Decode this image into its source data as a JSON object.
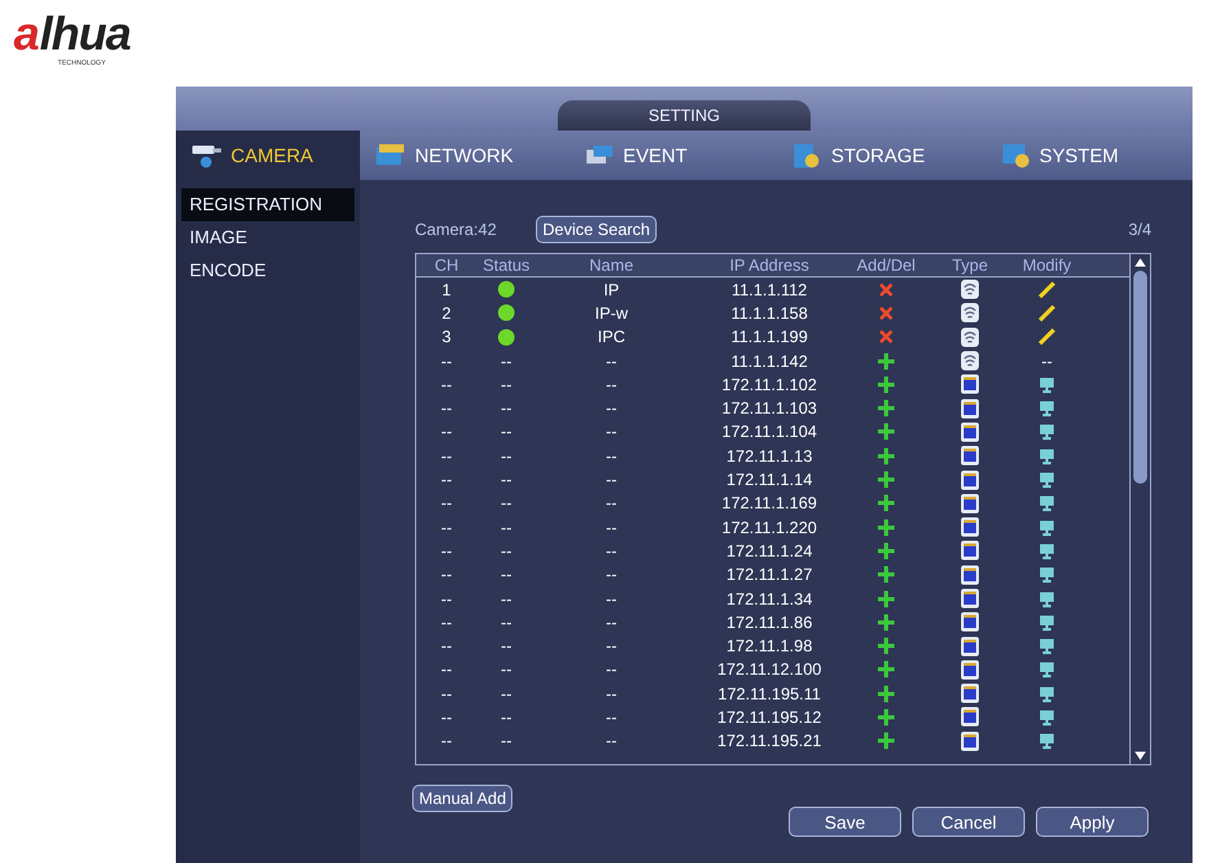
{
  "logo": {
    "mark": "a",
    "name": "lhua",
    "tagline": "TECHNOLOGY"
  },
  "window": {
    "title": "SETTING"
  },
  "tabs": [
    {
      "label": "CAMERA",
      "kind": "camera",
      "selected": true
    },
    {
      "label": "NETWORK",
      "kind": "network",
      "selected": false
    },
    {
      "label": "EVENT",
      "kind": "event",
      "selected": false
    },
    {
      "label": "STORAGE",
      "kind": "storage",
      "selected": false
    },
    {
      "label": "SYSTEM",
      "kind": "system",
      "selected": false
    }
  ],
  "sidebar": {
    "items": [
      {
        "label": "REGISTRATION",
        "selected": true
      },
      {
        "label": "IMAGE",
        "selected": false
      },
      {
        "label": "ENCODE",
        "selected": false
      }
    ]
  },
  "camera_count": "Camera:42",
  "device_search_button": "Device Search",
  "page": "3/4",
  "table": {
    "columns": [
      "CH",
      "Status",
      "Name",
      "IP Address",
      "Add/Del",
      "Type",
      "Modify"
    ],
    "rows": [
      {
        "ch": "1",
        "online": true,
        "name": "IP",
        "ip": "11.1.1.112",
        "action": {
          "kind": "delete"
        },
        "device": {
          "kind": "dome"
        },
        "modify": {
          "kind": "edit"
        }
      },
      {
        "ch": "2",
        "online": true,
        "name": "IP-w",
        "ip": "11.1.1.158",
        "action": {
          "kind": "delete"
        },
        "device": {
          "kind": "dome"
        },
        "modify": {
          "kind": "edit"
        }
      },
      {
        "ch": "3",
        "online": true,
        "name": "IPC",
        "ip": "11.1.1.199",
        "action": {
          "kind": "delete"
        },
        "device": {
          "kind": "dome"
        },
        "modify": {
          "kind": "edit"
        }
      },
      {
        "ch": "--",
        "status": "--",
        "name": "--",
        "ip": "11.1.1.142",
        "action": {
          "kind": "add"
        },
        "device": {
          "kind": "dome"
        },
        "modify": {
          "kind": "text",
          "text": "--"
        }
      },
      {
        "ch": "--",
        "status": "--",
        "name": "--",
        "ip": "172.11.1.102",
        "action": {
          "kind": "add"
        },
        "device": {
          "kind": "box"
        },
        "modify": {
          "kind": "network"
        }
      },
      {
        "ch": "--",
        "status": "--",
        "name": "--",
        "ip": "172.11.1.103",
        "action": {
          "kind": "add"
        },
        "device": {
          "kind": "box"
        },
        "modify": {
          "kind": "network"
        }
      },
      {
        "ch": "--",
        "status": "--",
        "name": "--",
        "ip": "172.11.1.104",
        "action": {
          "kind": "add"
        },
        "device": {
          "kind": "box"
        },
        "modify": {
          "kind": "network"
        }
      },
      {
        "ch": "--",
        "status": "--",
        "name": "--",
        "ip": "172.11.1.13",
        "action": {
          "kind": "add"
        },
        "device": {
          "kind": "box"
        },
        "modify": {
          "kind": "network"
        }
      },
      {
        "ch": "--",
        "status": "--",
        "name": "--",
        "ip": "172.11.1.14",
        "action": {
          "kind": "add"
        },
        "device": {
          "kind": "box"
        },
        "modify": {
          "kind": "network"
        }
      },
      {
        "ch": "--",
        "status": "--",
        "name": "--",
        "ip": "172.11.1.169",
        "action": {
          "kind": "add"
        },
        "device": {
          "kind": "box"
        },
        "modify": {
          "kind": "network"
        }
      },
      {
        "ch": "--",
        "status": "--",
        "name": "--",
        "ip": "172.11.1.220",
        "action": {
          "kind": "add"
        },
        "device": {
          "kind": "box"
        },
        "modify": {
          "kind": "network"
        }
      },
      {
        "ch": "--",
        "status": "--",
        "name": "--",
        "ip": "172.11.1.24",
        "action": {
          "kind": "add"
        },
        "device": {
          "kind": "box"
        },
        "modify": {
          "kind": "network"
        }
      },
      {
        "ch": "--",
        "status": "--",
        "name": "--",
        "ip": "172.11.1.27",
        "action": {
          "kind": "add"
        },
        "device": {
          "kind": "box"
        },
        "modify": {
          "kind": "network"
        }
      },
      {
        "ch": "--",
        "status": "--",
        "name": "--",
        "ip": "172.11.1.34",
        "action": {
          "kind": "add"
        },
        "device": {
          "kind": "box"
        },
        "modify": {
          "kind": "network"
        }
      },
      {
        "ch": "--",
        "status": "--",
        "name": "--",
        "ip": "172.11.1.86",
        "action": {
          "kind": "add"
        },
        "device": {
          "kind": "box"
        },
        "modify": {
          "kind": "network"
        }
      },
      {
        "ch": "--",
        "status": "--",
        "name": "--",
        "ip": "172.11.1.98",
        "action": {
          "kind": "add"
        },
        "device": {
          "kind": "box"
        },
        "modify": {
          "kind": "network"
        }
      },
      {
        "ch": "--",
        "status": "--",
        "name": "--",
        "ip": "172.11.12.100",
        "action": {
          "kind": "add"
        },
        "device": {
          "kind": "box"
        },
        "modify": {
          "kind": "network"
        }
      },
      {
        "ch": "--",
        "status": "--",
        "name": "--",
        "ip": "172.11.195.11",
        "action": {
          "kind": "add"
        },
        "device": {
          "kind": "box"
        },
        "modify": {
          "kind": "network"
        }
      },
      {
        "ch": "--",
        "status": "--",
        "name": "--",
        "ip": "172.11.195.12",
        "action": {
          "kind": "add"
        },
        "device": {
          "kind": "box"
        },
        "modify": {
          "kind": "network"
        }
      },
      {
        "ch": "--",
        "status": "--",
        "name": "--",
        "ip": "172.11.195.21",
        "action": {
          "kind": "add"
        },
        "device": {
          "kind": "box"
        },
        "modify": {
          "kind": "network"
        }
      }
    ]
  },
  "manual_add_button": "Manual Add",
  "buttons": [
    "Save",
    "Cancel",
    "Apply"
  ]
}
